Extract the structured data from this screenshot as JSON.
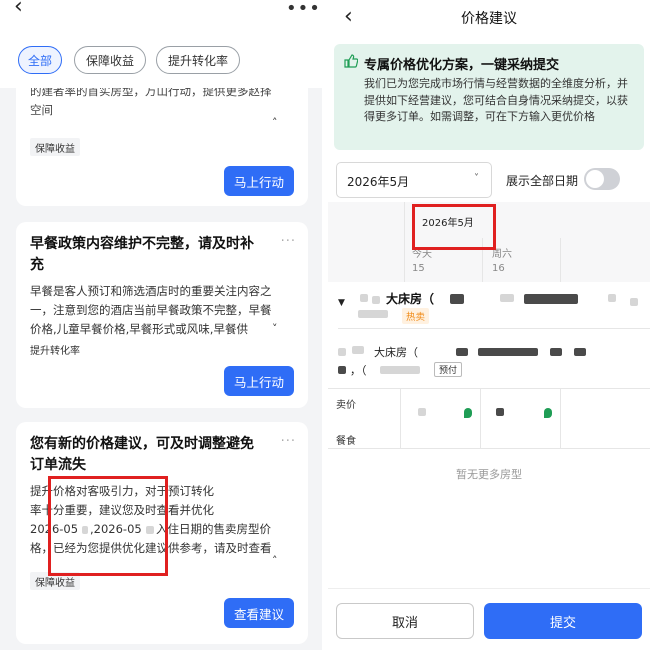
{
  "left": {
    "back_icon": "chevron-left-icon",
    "more_icon": "more-horizontal-icon",
    "chips": [
      {
        "label": "全部",
        "active": true
      },
      {
        "label": "保障收益",
        "active": false
      },
      {
        "label": "提升转化率",
        "active": false
      }
    ],
    "cards": [
      {
        "partial_text_lines": [
          "的建者率的首实房型，万山行动，提供更多赵择",
          "空间"
        ],
        "tag": "保障收益",
        "button": "马上行动"
      },
      {
        "title_lines": [
          "早餐政策内容维护不完整，请及时补",
          "充"
        ],
        "body_lines": [
          "早餐是客人预订和筛选酒店时的重要关注内容之",
          "一，注意到您的酒店当前早餐政策不完整，早餐",
          "价格,儿童早餐价格,早餐形式或风味,早餐供"
        ],
        "tag": "提升转化率",
        "button": "马上行动"
      },
      {
        "title_lines": [
          "您有新的价格建议，可及时调整避免",
          "订单流失"
        ],
        "body_lines": [
          "提升价格对客吸引力，对于预订转化",
          "率十分重要，建议您及时查看并优化",
          "2026-05",
          ",2026-05",
          "入住日期的售卖房型价",
          "格，已经为您提供优化建议供参考，请及时查看"
        ],
        "tag": "保障收益",
        "button": "查看建议"
      }
    ],
    "colors": {
      "accent": "#2f6df6",
      "highlight_box": "#e02020"
    }
  },
  "right": {
    "back_icon": "chevron-left-icon",
    "title": "价格建议",
    "notice": {
      "icon": "thumbs-up-icon",
      "title": "专属价格优化方案，一键采纳提交",
      "body": "我们已为您完成市场行情与经营数据的全维度分析，并提供如下经营建议，您可结合自身情况采纳提交，以获得更多订单。如需调整，可在下方输入更优价格"
    },
    "month_select": {
      "value": "2026年5月"
    },
    "show_all_dates": {
      "label": "展示全部日期",
      "on": false
    },
    "calendar": {
      "month_label": "2026年5月",
      "days": [
        {
          "label": "今天",
          "date": "15"
        },
        {
          "label": "周六",
          "date": "16"
        }
      ]
    },
    "rooms": [
      {
        "name": "大床房（",
        "badge": "热卖"
      },
      {
        "name": "大床房（",
        "prefix": "，（",
        "badge": "预付"
      }
    ],
    "rows": {
      "price": "卖价",
      "meal": "餐食"
    },
    "no_more": "暂无更多房型",
    "footer": {
      "cancel": "取消",
      "submit": "提交"
    }
  }
}
